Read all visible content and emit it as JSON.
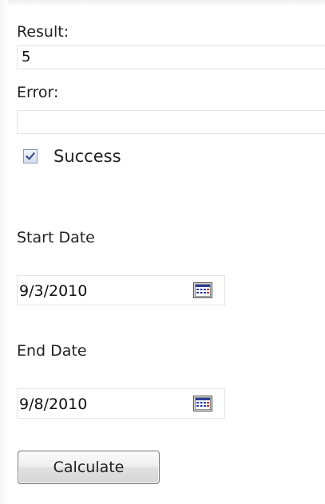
{
  "result": {
    "label": "Result:",
    "value": "5"
  },
  "error": {
    "label": "Error:",
    "value": ""
  },
  "success": {
    "label": "Success",
    "checked": true
  },
  "start_date": {
    "label": "Start Date",
    "value": "9/3/2010",
    "icon": "calendar-icon"
  },
  "end_date": {
    "label": "End Date",
    "value": "9/8/2010",
    "icon": "calendar-icon"
  },
  "calculate": {
    "label": "Calculate"
  },
  "colors": {
    "text": "#222222",
    "field_border": "#e3e3e3",
    "checkbox_border": "#8a9cb8",
    "checkmark": "#3b4f86",
    "calendar_blue": "#2b3f9e",
    "calendar_red": "#c42020",
    "button_border": "#7c7c7c"
  }
}
